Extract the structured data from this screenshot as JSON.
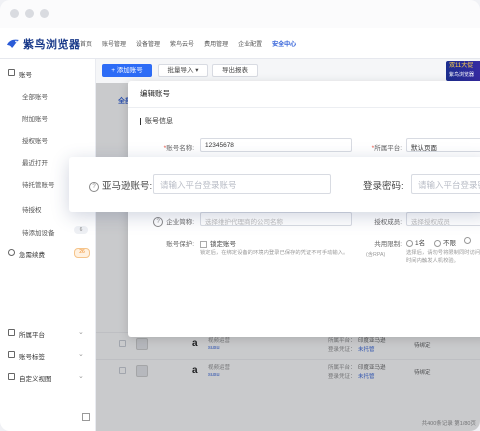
{
  "app": {
    "name": "紫鸟浏览器"
  },
  "nav": {
    "items": [
      "首页",
      "账号管理",
      "设备管理",
      "紫鸟云号",
      "费用管理",
      "企业配置",
      "安全中心"
    ]
  },
  "banner": {
    "line1": "双11大促",
    "line2": "紫鸟浏览器"
  },
  "sidebar": {
    "head": {
      "label": "账号"
    },
    "items": [
      {
        "label": "全部账号"
      },
      {
        "label": "附加账号"
      },
      {
        "label": "授权账号"
      },
      {
        "label": "最近打开"
      },
      {
        "label": "待托管账号"
      },
      {
        "label": "待授权"
      },
      {
        "label": "待添加设备",
        "count": "6"
      }
    ],
    "renewal": {
      "label": "急需续费",
      "count": "26"
    },
    "bottom": [
      {
        "label": "所属平台"
      },
      {
        "label": "账号标签"
      },
      {
        "label": "自定义视图"
      }
    ]
  },
  "toolbar": {
    "add": "+ 添加账号",
    "import": "批量导入 ▾",
    "export": "导出报表"
  },
  "table": {
    "tab": "全部",
    "rows": [
      {
        "name": "视频运营",
        "user": "susu",
        "plat1": "所属平台：",
        "plat1_v": "印度亚马逊",
        "plat2": "登录凭证：",
        "plat2_v": "未托管",
        "status": "待绑定"
      },
      {
        "name": "视频运营",
        "user": "susu",
        "plat1": "所属平台：",
        "plat1_v": "印度亚马逊",
        "plat2": "登录凭证：",
        "plat2_v": "未托管",
        "status": "待绑定"
      }
    ],
    "footer": "共400条记录 第1/80页"
  },
  "modal": {
    "title": "编辑账号",
    "section": "账号信息",
    "name_label": "账号名称:",
    "name_value": "12345678",
    "platform_label": "所属平台:",
    "platform_value": "默认页面",
    "company_label": "企业简称:",
    "company_ph": "选择维护代理商的公司名称",
    "member_label": "授权成员:",
    "member_ph": "选择授权成员",
    "protect_label": "账号保护:",
    "protect_check": "锁定账号",
    "protect_note": "锁定后，在绑定设备的环境内登录已保存的凭证不可手动输入。",
    "share_label": "共用限制:",
    "share_opt1": "1名",
    "share_opt2": "不限",
    "share_rpa": "(含RPA)",
    "share_note": "选择后，请勿号将限制同时访问的时间内触发人机校验。"
  },
  "highlight": {
    "amazon_label": "亚马逊账号:",
    "amazon_ph": "请输入平台登录账号",
    "password_label": "登录密码:",
    "password_ph": "请输入平台登录密码"
  }
}
